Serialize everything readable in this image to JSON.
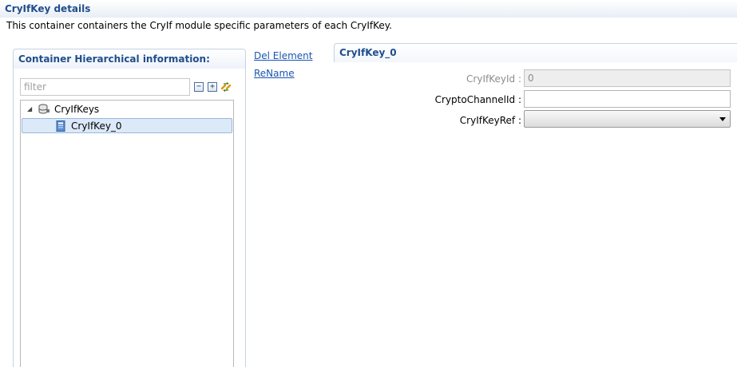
{
  "section": {
    "title": "CryIfKey details",
    "description": "This container containers the CryIf module specific parameters of each CryIfKey."
  },
  "left_panel": {
    "title": "Container Hierarchical information:",
    "filter_placeholder": "filter",
    "toolbar": {
      "collapse_icon": "collapse-all-icon",
      "expand_icon": "expand-all-icon",
      "link_icon": "link-with-editor-icon"
    },
    "tree": {
      "root": {
        "label": "CryIfKeys",
        "icon": "container-list-icon",
        "expanded": true
      },
      "children": [
        {
          "label": "CryIfKey_0",
          "icon": "container-item-icon",
          "selected": true
        }
      ]
    }
  },
  "actions": {
    "del_element": "Del Element",
    "rename": "ReName"
  },
  "right_panel": {
    "title": "CryIfKey_0",
    "fields": {
      "key_id": {
        "label": "CryIfKeyId :",
        "value": "0",
        "disabled": true
      },
      "crypto_channel_id": {
        "label": "CryptoChannelId :",
        "value": ""
      },
      "key_ref": {
        "label": "CryIfKeyRef :",
        "value": ""
      }
    }
  },
  "colors": {
    "title_blue": "#1f4e8c",
    "link_blue": "#1a56b0",
    "selection": "#dce9f8"
  }
}
